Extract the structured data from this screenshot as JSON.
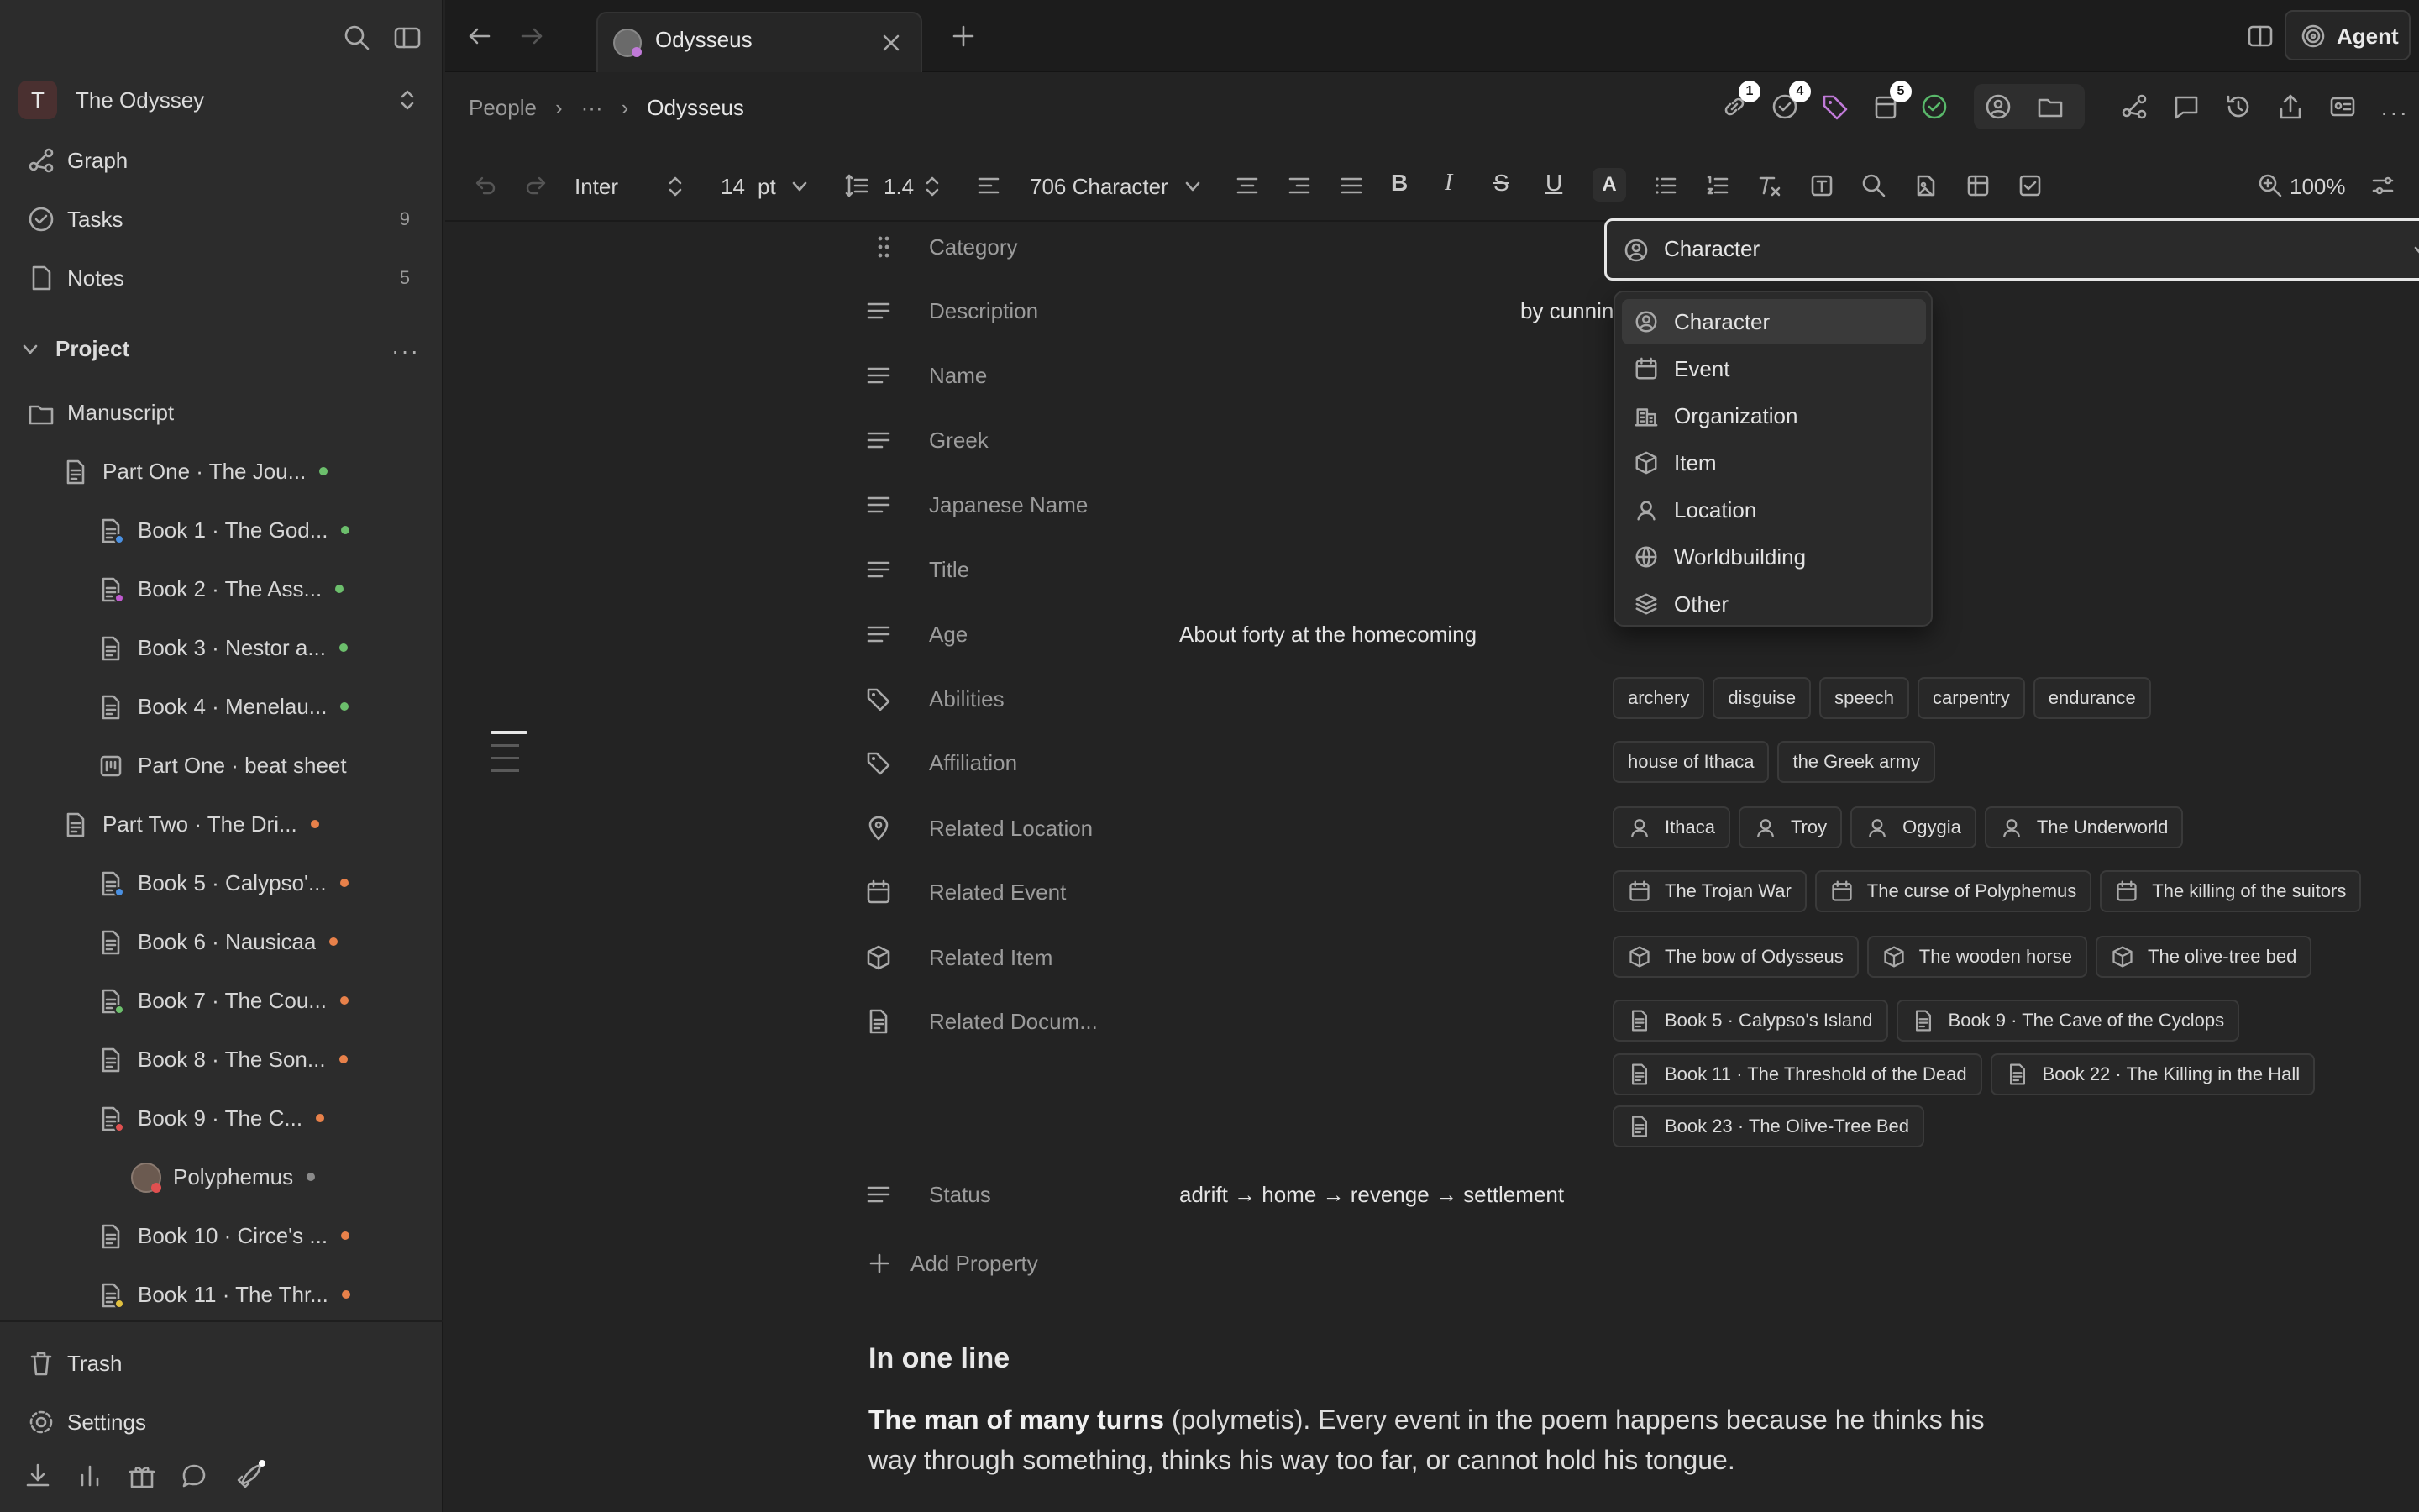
{
  "sidebar": {
    "workspace": {
      "initial": "T",
      "name": "The Odyssey"
    },
    "nav": [
      {
        "label": "Graph",
        "count": "",
        "icon": "graph-icon"
      },
      {
        "label": "Tasks",
        "count": "9",
        "icon": "tasks-icon"
      },
      {
        "label": "Notes",
        "count": "5",
        "icon": "notes-icon"
      }
    ],
    "section_title": "Project",
    "tree": [
      {
        "label": "Manuscript",
        "indent": 0,
        "icon": "folder-icon",
        "dot": ""
      },
      {
        "label": "Part One · The Jou...",
        "indent": 1,
        "icon": "document-icon",
        "dot": "#6cbf6c"
      },
      {
        "label": "Book 1 · The God...",
        "indent": 2,
        "icon": "document-icon",
        "dot": "#6cbf6c",
        "badge": "#4a90e2"
      },
      {
        "label": "Book 2 · The Ass...",
        "indent": 2,
        "icon": "document-icon",
        "dot": "#6cbf6c",
        "badge": "#c05ad0"
      },
      {
        "label": "Book 3 · Nestor a...",
        "indent": 2,
        "icon": "document-icon",
        "dot": "#6cbf6c"
      },
      {
        "label": "Book 4 · Menelau...",
        "indent": 2,
        "icon": "document-icon",
        "dot": "#6cbf6c"
      },
      {
        "label": "Part One · beat sheet",
        "indent": 2,
        "icon": "board-icon",
        "dot": ""
      },
      {
        "label": "Part Two · The Dri...",
        "indent": 1,
        "icon": "document-icon",
        "dot": "#e8814a"
      },
      {
        "label": "Book 5 · Calypso'...",
        "indent": 2,
        "icon": "document-icon",
        "dot": "#e8814a",
        "badge": "#4a90e2"
      },
      {
        "label": "Book 6 · Nausicaa",
        "indent": 2,
        "icon": "document-icon",
        "dot": "#e8814a"
      },
      {
        "label": "Book 7 · The Cou...",
        "indent": 2,
        "icon": "document-icon",
        "dot": "#e8814a",
        "badge": "#6cbf6c"
      },
      {
        "label": "Book 8 · The Son...",
        "indent": 2,
        "icon": "document-icon",
        "dot": "#e8814a"
      },
      {
        "label": "Book 9 · The C...",
        "indent": 2,
        "icon": "document-icon",
        "dot": "#e8814a",
        "badge": "#e05050"
      },
      {
        "label": "Polyphemus",
        "indent": 3,
        "icon": "avatar-icon",
        "dot": "#8a8a8a"
      },
      {
        "label": "Book 10 · Circe's ...",
        "indent": 2,
        "icon": "document-icon",
        "dot": "#e8814a"
      },
      {
        "label": "Book 11 · The Thr...",
        "indent": 2,
        "icon": "document-icon",
        "dot": "#e8814a",
        "badge": "#e0c040"
      }
    ],
    "trash": "Trash",
    "settings": "Settings"
  },
  "tabbar": {
    "tab_title": "Odysseus",
    "agent_label": "Agent"
  },
  "breadcrumb": {
    "root": "People",
    "ellipsis": "···",
    "current": "Odysseus"
  },
  "header_badges": {
    "links": "1",
    "tasks": "4",
    "pages": "5"
  },
  "toolbar": {
    "font": "Inter",
    "size": "14",
    "size_unit": "pt",
    "line_height": "1.4",
    "style": "706 Character",
    "zoom": "100%"
  },
  "properties": {
    "category": {
      "label": "Category",
      "value": "Character"
    },
    "rows": [
      {
        "label": "Description",
        "value": "by cunning and loses twenty years to it."
      },
      {
        "label": "Name",
        "value": ""
      },
      {
        "label": "Greek",
        "value": ""
      },
      {
        "label": "Japanese Name",
        "value": ""
      },
      {
        "label": "Title",
        "value": ""
      },
      {
        "label": "Age",
        "value": "About forty at the homecoming"
      }
    ],
    "abilities": {
      "label": "Abilities",
      "tags": [
        "archery",
        "disguise",
        "speech",
        "carpentry",
        "endurance"
      ]
    },
    "affiliation": {
      "label": "Affiliation",
      "tags": [
        "house of Ithaca",
        "the Greek army"
      ]
    },
    "related_location": {
      "label": "Related Location",
      "items": [
        "Ithaca",
        "Troy",
        "Ogygia",
        "The Underworld"
      ]
    },
    "related_event": {
      "label": "Related Event",
      "items": [
        "The Trojan War",
        "The curse of Polyphemus",
        "The killing of the suitors"
      ]
    },
    "related_item": {
      "label": "Related Item",
      "items": [
        "The bow of Odysseus",
        "The wooden horse",
        "The olive-tree bed"
      ]
    },
    "related_documents": {
      "label": "Related Docum...",
      "items": [
        "Book 5 · Calypso's Island",
        "Book 9 · The Cave of the Cyclops",
        "Book 11 · The Threshold of the Dead",
        "Book 22 · The Killing in the Hall",
        "Book 23 · The Olive-Tree Bed"
      ]
    },
    "status": {
      "label": "Status",
      "value": "adrift → home → revenge → settlement"
    },
    "add_property": "Add Property"
  },
  "dropdown": {
    "options": [
      {
        "label": "Character",
        "icon": "person-icon",
        "selected": true
      },
      {
        "label": "Event",
        "icon": "calendar-icon"
      },
      {
        "label": "Organization",
        "icon": "building-icon"
      },
      {
        "label": "Item",
        "icon": "cube-icon"
      },
      {
        "label": "Location",
        "icon": "location-person-icon"
      },
      {
        "label": "Worldbuilding",
        "icon": "globe-icon"
      },
      {
        "label": "Other",
        "icon": "layers-icon"
      }
    ]
  },
  "body": {
    "heading": "In one line",
    "bold": "The man of many turns",
    "text": " (polymetis). Every event in the poem happens because he thinks his way through something, thinks his way too far, or cannot hold his tongue."
  },
  "colors": {
    "accent_green": "#59b86a",
    "tag_purple": "#c07ad8"
  }
}
